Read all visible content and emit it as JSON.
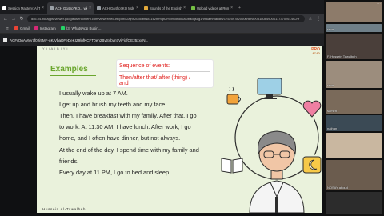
{
  "colors": {
    "slide_bg": "#eaf2dc",
    "heading_green": "#6aa62d",
    "note_red": "#e0221f",
    "browser_dark": "#35363a"
  },
  "browser": {
    "tabs": [
      {
        "label": "Session Mastery: Al-Tawalbeh",
        "favicon_color": "#ffffff",
        "active": false
      },
      {
        "label": "ACH Gq4hp7KQ... wkl Mz...",
        "favicon_color": "#9aa0a6",
        "active": true
      },
      {
        "label": "ACH Gq4hp7KQ Mds Mds...",
        "favicon_color": "#9aa0a6",
        "active": false
      },
      {
        "label": "Sounds of the English language",
        "favicon_color": "#e2a93b",
        "active": false
      },
      {
        "label": "Upload videos at Rumble",
        "favicon_color": "#75c044",
        "active": false
      }
    ],
    "url": "doc-04-bo-apps-viewer.googleusercontent.com/viewer/secure/pdf/52ajhn2ujdqbhs81162nfmqn2mr/n6dnok6ai0baoqsug1nmkammakdm/1752597820000/drive/08180849006117370761/ACFr",
    "bookmarks": [
      {
        "label": "Gmail",
        "icon": "gmail-icon",
        "color": "#ea4335"
      },
      {
        "label": "Instagram",
        "icon": "instagram-icon",
        "color": "#d62976"
      },
      {
        "label": "(3) WhatsApp Busin...",
        "icon": "whatsapp-icon",
        "color": "#25d366"
      }
    ],
    "viewer_bar_title": "ACFrOgAMyy7f02j9MF-uK/VbaDFeDeKIZ9lpfKCFT0en2BvSvbvn7VjFjxfQE25xxvN..."
  },
  "slide": {
    "top_label": "Y i i A l B l Y i",
    "heading": "Examples",
    "logo_line1": "PRO",
    "logo_line2": "ACAD",
    "note": {
      "title": "Sequence of events:",
      "line1": "Then/after that/ after (thing) /",
      "line2": "and"
    },
    "paragraph_lines": [
      "I usually wake up at 7 AM.",
      "I get up and brush my teeth and my face.",
      "Then, I have breakfast with my family. After that, I go",
      "to work. At 11:30 AM, I have lunch. After work, I go",
      "home, and I often have dinner, but not always.",
      "At the end of the day, I spend time with my family and",
      "friends.",
      "Every day at 11 PM, I go to bed and sleep."
    ],
    "footer": "Hussein Al-Tawalbeh"
  },
  "participants": [
    {
      "name": "",
      "bg": "#8d7b6a"
    },
    {
      "name": "rana",
      "bg": "#6f7f88"
    },
    {
      "name": "F. Hussein Tawalbeh",
      "bg": "#4a3f3a"
    },
    {
      "name": "rana",
      "bg": "#9c8d7d"
    },
    {
      "name": "sameh",
      "bg": "#7a6a5a"
    },
    {
      "name": "nathan",
      "bg": "#3b4a55"
    },
    {
      "name": "",
      "bg": "#c9b7a0"
    },
    {
      "name": "NOSAY aboud",
      "bg": "#6b5c4e"
    },
    {
      "name": "",
      "bg": "#2c2c2c"
    }
  ]
}
